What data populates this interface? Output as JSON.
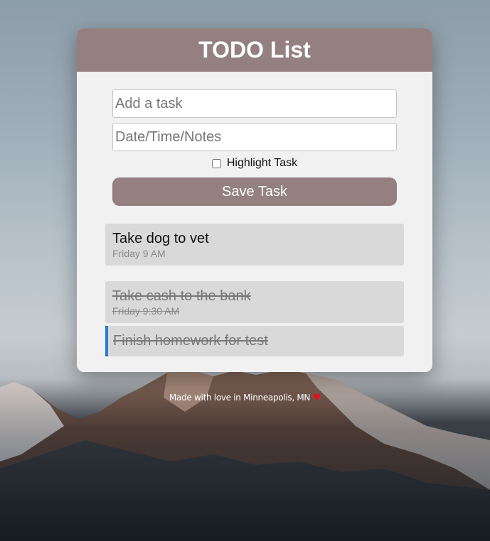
{
  "header": {
    "title": "TODO List"
  },
  "form": {
    "task_placeholder": "Add a task",
    "notes_placeholder": "Date/Time/Notes",
    "highlight_label": "Highlight Task",
    "highlight_checked": false,
    "save_label": "Save Task"
  },
  "tasks": [
    {
      "title": "Take dog to vet",
      "notes": "Friday 9 AM",
      "completed": false,
      "highlighted": false
    },
    {
      "title": "Take cash to the bank",
      "notes": "Friday 9:30 AM",
      "completed": true,
      "highlighted": false
    },
    {
      "title": "Finish homework for test",
      "notes": "",
      "completed": true,
      "highlighted": true
    }
  ],
  "footer": {
    "text": "Made with love in Minneapolis, MN",
    "heart": "♥"
  },
  "colors": {
    "accent": "#948080",
    "card_bg": "#f1f1f1",
    "task_bg": "#d9d9d9",
    "highlight_border": "#2b7bd1",
    "heart": "#e0111a"
  }
}
